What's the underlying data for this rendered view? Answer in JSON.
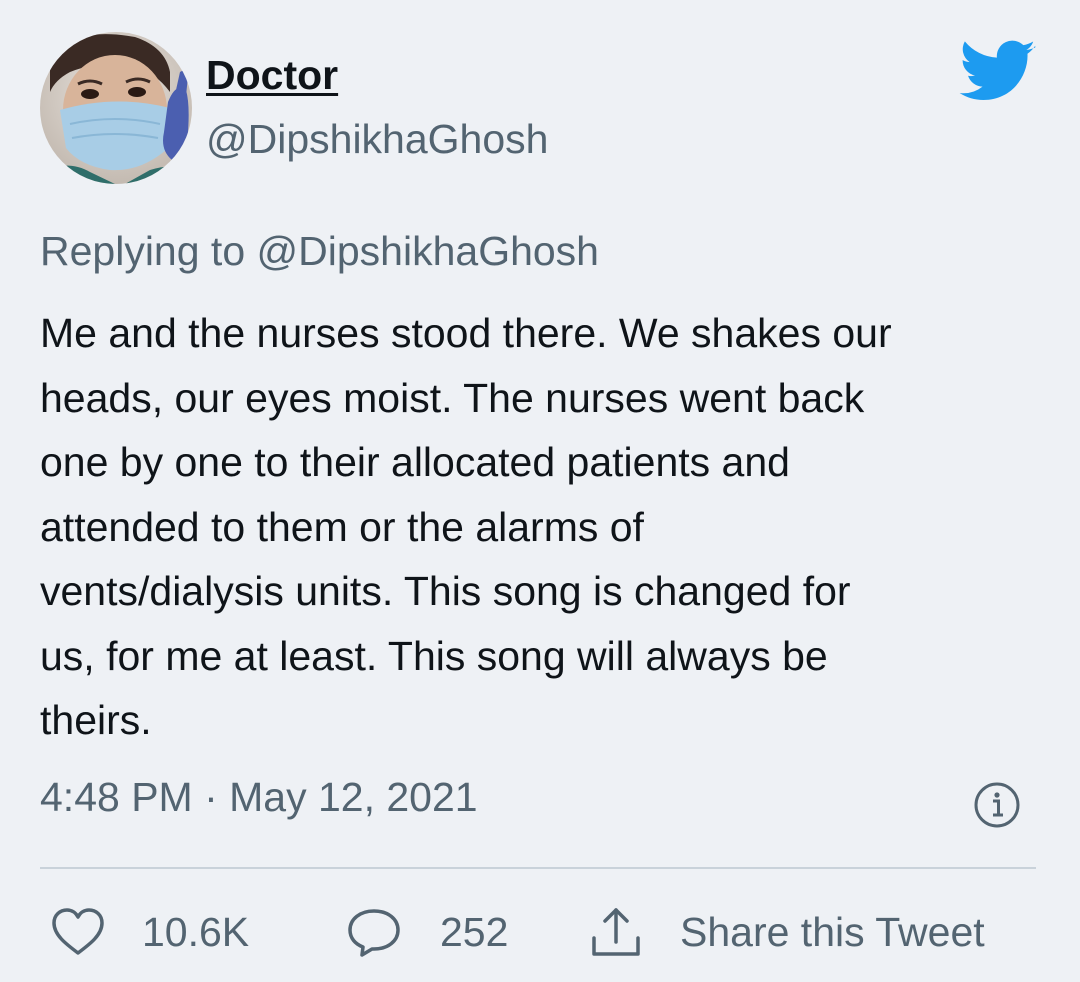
{
  "tweet": {
    "author": {
      "display_name": "Doctor",
      "handle": "@DipshikhaGhosh",
      "avatar_icon": "avatar-masked-doctor"
    },
    "platform_icon": "twitter-bird-icon",
    "replying_prefix": "Replying to",
    "replying_to": "@DipshikhaGhosh",
    "text_lines": [
      "Me and the nurses stood there. We shakes our",
      "heads, our eyes moist. The nurses went back",
      "one by one to their allocated patients and",
      "attended to them or the alarms of",
      "vents/dialysis units. This song is changed for",
      "us, for me at least. This song will always be",
      "theirs."
    ],
    "timestamp": "4:48 PM · May 12, 2021",
    "actions": {
      "like_count": "10.6K",
      "reply_count": "252",
      "share_label": "Share this Tweet"
    }
  },
  "colors": {
    "background": "#eef1f5",
    "text_primary": "#0f1419",
    "text_secondary": "#536471",
    "twitter_blue": "#1d9bf0",
    "divider": "#c9d2da"
  }
}
